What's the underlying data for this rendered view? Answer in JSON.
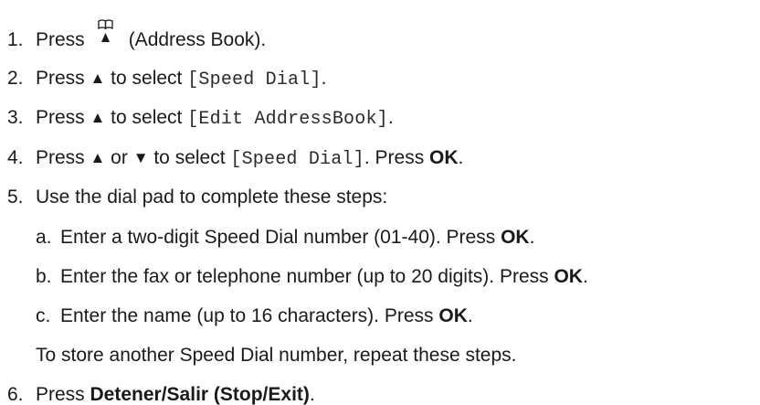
{
  "steps": [
    {
      "num": "1.",
      "pre": "Press",
      "icon": "address-book-icon",
      "post": "(Address Book)."
    },
    {
      "num": "2.",
      "pre": "Press ",
      "arrow": "▲",
      "mid": " to select ",
      "code": "[Speed Dial]",
      "post": "."
    },
    {
      "num": "3.",
      "pre": "Press ",
      "arrow": "▲",
      "mid": " to select ",
      "code": "[Edit AddressBook]",
      "post": "."
    },
    {
      "num": "4.",
      "pre": "Press ",
      "arrow_up": "▲",
      "or": " or ",
      "arrow_down": "▼",
      "mid": " to select ",
      "code": "[Speed Dial]",
      "post": ". Press ",
      "bold": "OK",
      "end": "."
    },
    {
      "num": "5.",
      "text": "Use the dial pad to complete these steps:"
    },
    {
      "num": "6.",
      "pre": "Press ",
      "bold": "Detener/Salir (Stop/Exit)",
      "post": "."
    }
  ],
  "substeps": [
    {
      "letter": "a.",
      "text": "Enter a two-digit Speed Dial number (01-40). Press ",
      "bold": "OK",
      "end": "."
    },
    {
      "letter": "b.",
      "text": "Enter the fax or telephone number (up to 20 digits). Press ",
      "bold": "OK",
      "end": "."
    },
    {
      "letter": "c.",
      "text": "Enter the name (up to 16 characters). Press ",
      "bold": "OK",
      "end": "."
    }
  ],
  "note": "To store another Speed Dial number, repeat these steps."
}
